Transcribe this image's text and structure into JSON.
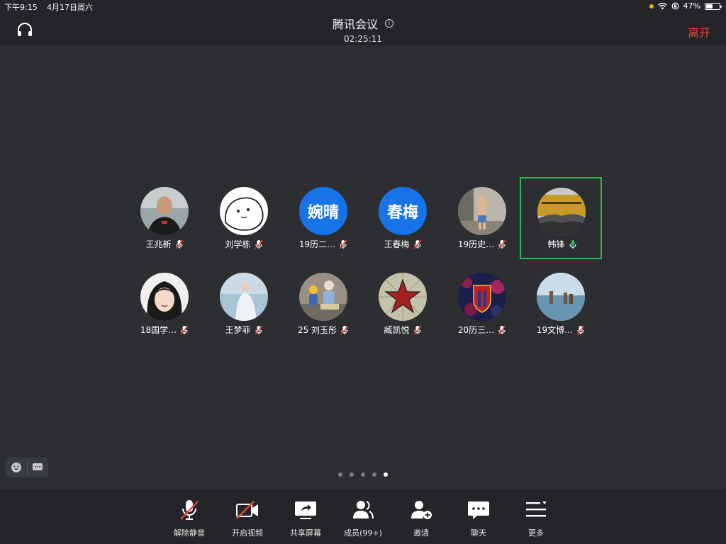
{
  "status": {
    "time": "下午9:15",
    "date": "4月17日周六",
    "battery": "47%"
  },
  "header": {
    "title": "腾讯会议",
    "timer": "02:25:11",
    "leave": "离开"
  },
  "participants": [
    {
      "name": "王兆新",
      "mic": "muted"
    },
    {
      "name": "刘学栋",
      "mic": "muted"
    },
    {
      "name": "19历二…",
      "mic": "muted",
      "avatar_text": "婉晴"
    },
    {
      "name": "王春梅",
      "mic": "muted",
      "avatar_text": "春梅"
    },
    {
      "name": "19历史…",
      "mic": "muted"
    },
    {
      "name": "韩锋",
      "mic": "speaking"
    },
    {
      "name": "18国学…",
      "mic": "muted"
    },
    {
      "name": "王梦菲",
      "mic": "muted"
    },
    {
      "name": "25 刘玉彤",
      "mic": "muted"
    },
    {
      "name": "臧凯悦",
      "mic": "muted"
    },
    {
      "name": "20历三…",
      "mic": "muted"
    },
    {
      "name": "19文博…",
      "mic": "muted"
    }
  ],
  "pages": {
    "count": 5,
    "current": 5
  },
  "toolbar": {
    "unmute": "解除静音",
    "video": "开启视频",
    "share": "共享屏幕",
    "members": "成员(99+)",
    "invite": "邀请",
    "chat": "聊天",
    "more": "更多"
  },
  "colors": {
    "accent_blue": "#1674e8",
    "leave_red": "#e8453c",
    "active_green": "#2fb45a",
    "mute_red": "#e8453c"
  }
}
